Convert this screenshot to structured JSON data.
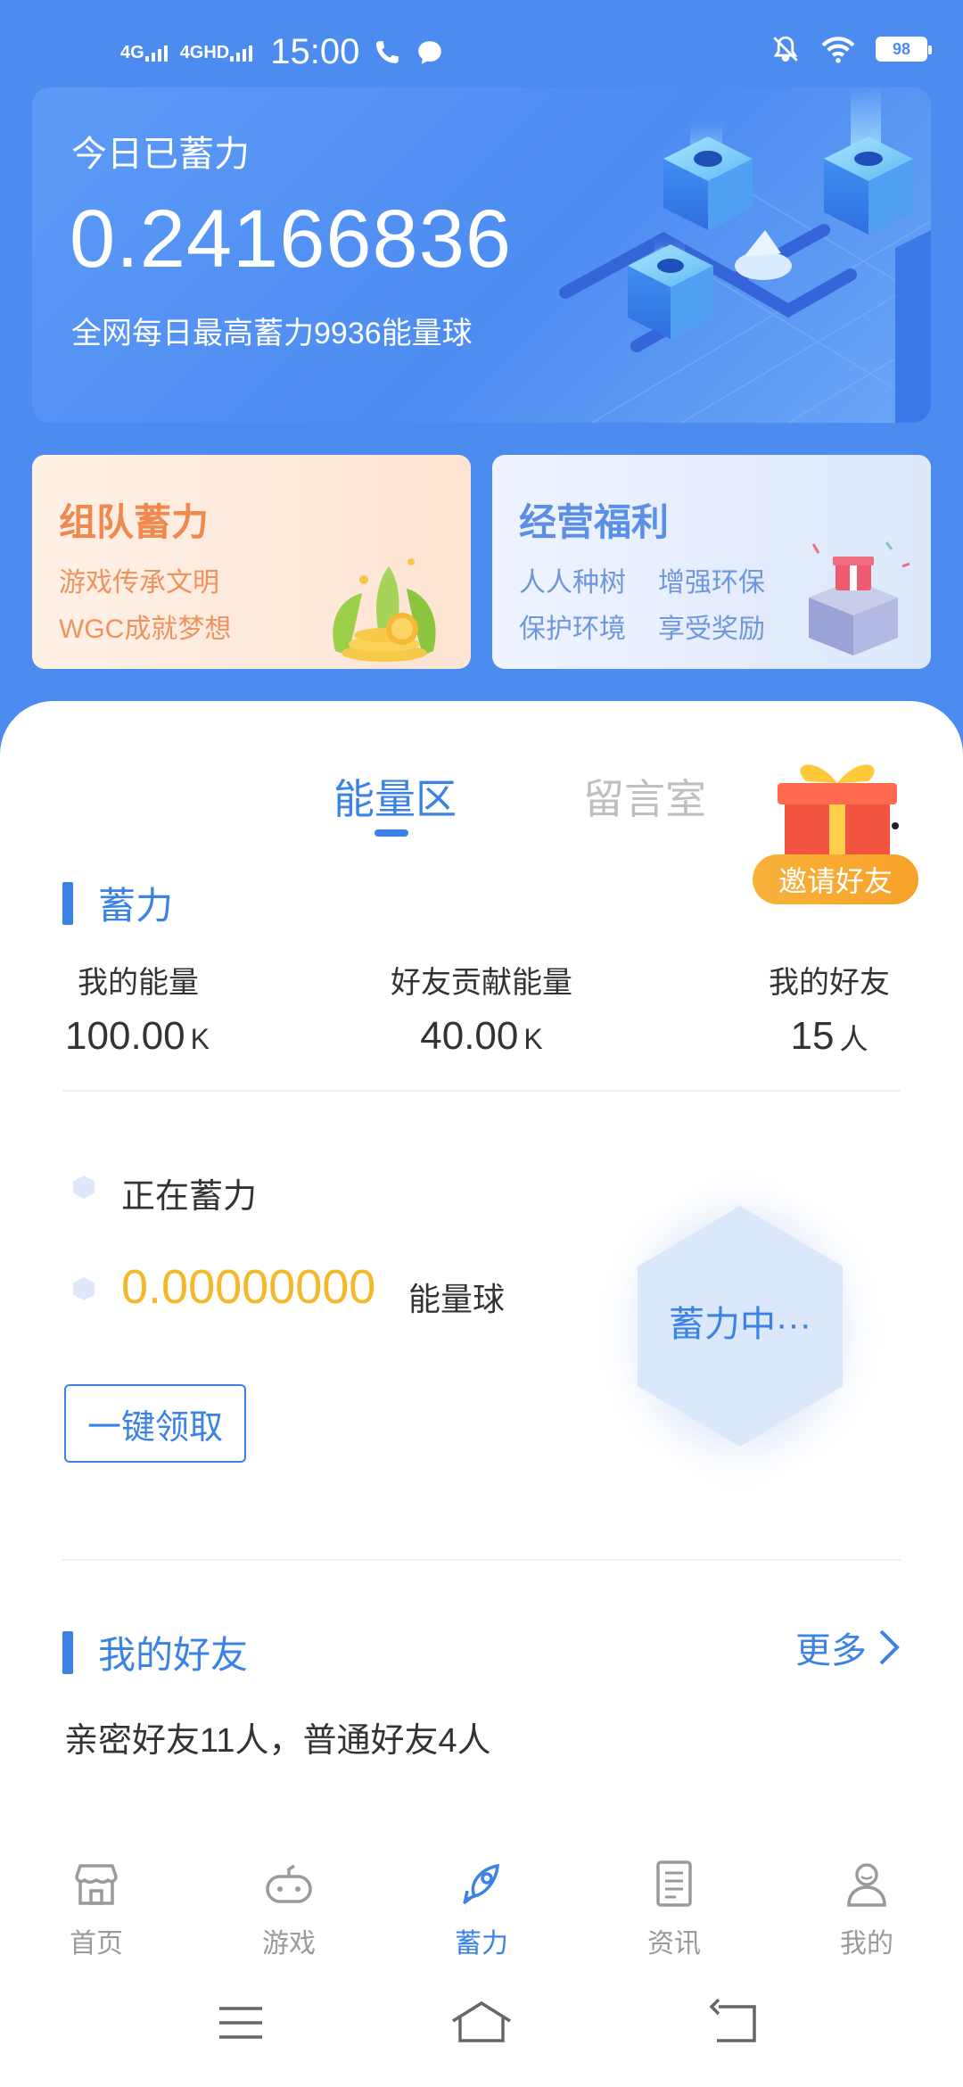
{
  "status_bar": {
    "network1": "4G",
    "network2": "4GHD",
    "time": "15:00",
    "battery": "98",
    "icons": [
      "phone-icon",
      "message-icon",
      "mute-icon",
      "wifi-icon",
      "battery-icon"
    ]
  },
  "hero": {
    "title": "今日已蓄力",
    "value": "0.24166836",
    "subtitle": "全网每日最高蓄力9936能量球"
  },
  "promo_team": {
    "title": "组队蓄力",
    "line1": "游戏传承文明",
    "line2": "WGC成就梦想"
  },
  "promo_welfare": {
    "title": "经营福利",
    "line1a": "人人种树",
    "line1b": "增强环保",
    "line2a": "保护环境",
    "line2b": "享受奖励"
  },
  "tabs": {
    "energy": "能量区",
    "message": "留言室",
    "active": "energy"
  },
  "invite": {
    "label": "邀请好友"
  },
  "energy_section": {
    "title": "蓄力",
    "stats": [
      {
        "label": "我的能量",
        "value": "100.00",
        "unit": "K"
      },
      {
        "label": "好友贡献能量",
        "value": "40.00",
        "unit": "K"
      },
      {
        "label": "我的好友",
        "value": "15",
        "unit": "人"
      }
    ],
    "charging_label": "正在蓄力",
    "charge_value": "0.00000000",
    "charge_unit": "能量球",
    "collect_button": "一键领取",
    "hex_status": "蓄力中···"
  },
  "friends_section": {
    "title": "我的好友",
    "more": "更多",
    "summary": "亲密好友11人，普通好友4人"
  },
  "bottom_nav": {
    "items": [
      {
        "label": "首页",
        "icon": "store-icon"
      },
      {
        "label": "游戏",
        "icon": "gamepad-icon"
      },
      {
        "label": "蓄力",
        "icon": "rocket-icon"
      },
      {
        "label": "资讯",
        "icon": "news-icon"
      },
      {
        "label": "我的",
        "icon": "user-icon"
      }
    ],
    "active_index": 2
  },
  "colors": {
    "primary": "#3b82e6",
    "background": "#4c8bef",
    "accent_orange": "#f0894d",
    "accent_gold": "#f4b829"
  }
}
